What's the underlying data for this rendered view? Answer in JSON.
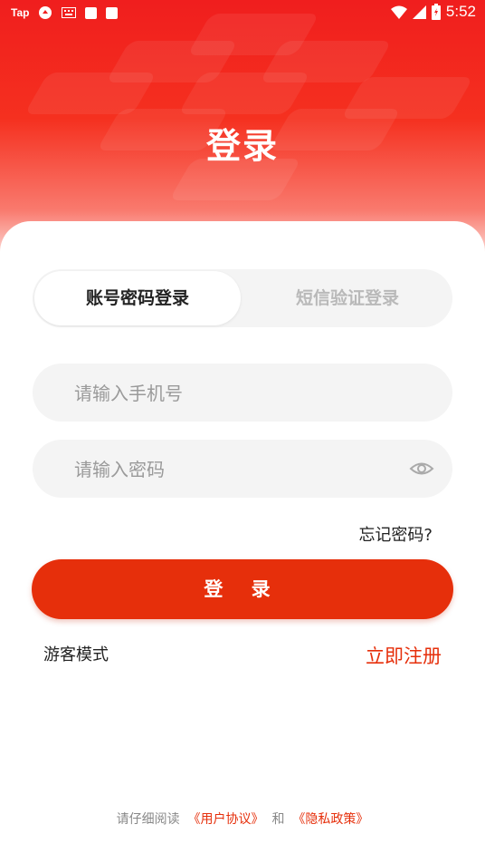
{
  "status_bar": {
    "app_icon_text": "Tap",
    "time": "5:52"
  },
  "header": {
    "title": "登录"
  },
  "tabs": {
    "active": "账号密码登录",
    "inactive": "短信验证登录"
  },
  "phone_field": {
    "placeholder": "请输入手机号",
    "value": ""
  },
  "password_field": {
    "placeholder": "请输入密码",
    "value": ""
  },
  "forgot_label": "忘记密码?",
  "login_button": "登 录",
  "guest_label": "游客模式",
  "register_label": "立即注册",
  "footer": {
    "prefix": "请仔细阅读",
    "user_agreement": "《用户协议》",
    "and": "和",
    "privacy_policy": "《隐私政策》"
  },
  "colors": {
    "accent": "#e62f0b",
    "header_red": "#f01e1e"
  }
}
